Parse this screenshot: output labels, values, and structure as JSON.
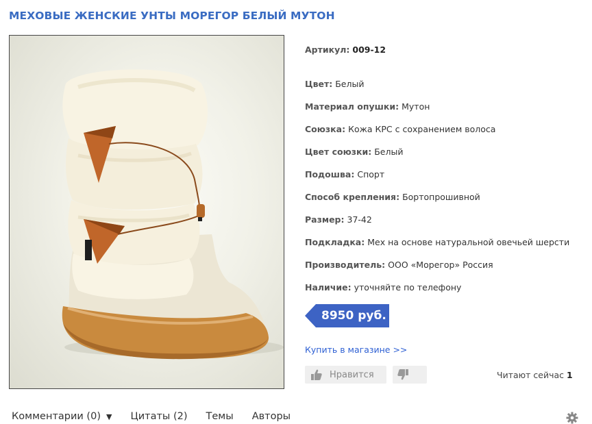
{
  "product": {
    "title": "МЕХОВЫЕ ЖЕНСКИЕ УНТЫ МОРЕГОР БЕЛЫЙ МУТОН",
    "image_icon": "boot-photo",
    "specs": [
      {
        "label": "Артикул:",
        "value": "009-12",
        "bold_value": true
      },
      {
        "label": "Цвет:",
        "value": "Белый"
      },
      {
        "label": "Материал опушки:",
        "value": "Мутон"
      },
      {
        "label": "Союзка:",
        "value": "Кожа КРС с сохранением волоса"
      },
      {
        "label": "Цвет союзки:",
        "value": "Белый"
      },
      {
        "label": "Подошва:",
        "value": "Спорт"
      },
      {
        "label": "Способ крепления:",
        "value": "Бортопрошивной"
      },
      {
        "label": "Размер:",
        "value": "37-42"
      },
      {
        "label": "Подкладка:",
        "value": "Мех на основе натуральной овечьей шерсти"
      },
      {
        "label": "Производитель:",
        "value": "ООО «Морегор» Россия"
      },
      {
        "label": "Наличие:",
        "value": "уточняйте по телефону"
      }
    ],
    "price": "8950 руб.",
    "buy_link": "Купить в магазине >>"
  },
  "actions": {
    "like_label": "Нравится",
    "like_icon": "thumbs-up-icon",
    "dislike_icon": "thumbs-down-icon",
    "reading_label": "Читают сейчас",
    "reading_count": "1"
  },
  "tabs": [
    {
      "label": "Комментарии (0)",
      "has_dropdown": true
    },
    {
      "label": "Цитаты (2)"
    },
    {
      "label": "Темы"
    },
    {
      "label": "Авторы"
    }
  ],
  "colors": {
    "title": "#3a6cc2",
    "price_tag": "#3d63c4",
    "link": "#2d5fd3"
  }
}
